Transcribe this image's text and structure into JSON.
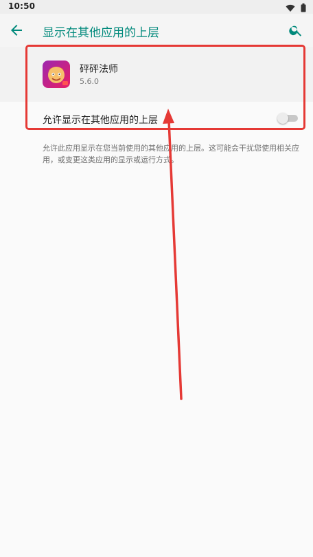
{
  "status_bar": {
    "time": "10:50"
  },
  "app_bar": {
    "title": "显示在其他应用的上层"
  },
  "app": {
    "name": "砰砰法师",
    "version": "5.6.0"
  },
  "setting": {
    "label": "允许显示在其他应用的上层",
    "enabled": false
  },
  "description": "允许此应用显示在您当前使用的其他应用的上层。这可能会干扰您使用相关应用，或变更这类应用的显示或运行方式。",
  "colors": {
    "accent": "#00897b",
    "annotation": "#e53935"
  },
  "icons": [
    "wifi-icon",
    "battery-icon",
    "back-arrow-icon",
    "search-icon",
    "app-icon"
  ]
}
